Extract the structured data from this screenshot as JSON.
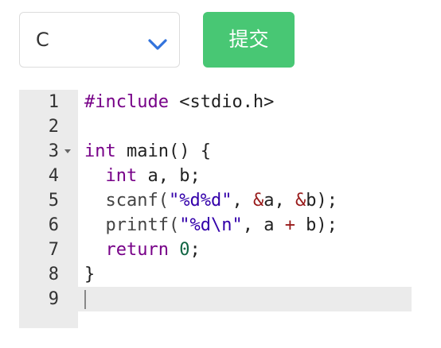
{
  "language_select": {
    "value": "C",
    "icon": "chevron-down-icon"
  },
  "submit_button": {
    "label": "提交",
    "color": "#48c774"
  },
  "editor": {
    "lines": [
      {
        "num": "1",
        "tokens": [
          {
            "t": "#include",
            "c": "kw"
          },
          {
            "t": " <stdio.h>",
            "c": "plain"
          }
        ]
      },
      {
        "num": "2",
        "tokens": []
      },
      {
        "num": "3",
        "fold": true,
        "tokens": [
          {
            "t": "int",
            "c": "ty"
          },
          {
            "t": " main() {",
            "c": "plain"
          }
        ]
      },
      {
        "num": "4",
        "tokens": [
          {
            "t": "  ",
            "c": "plain"
          },
          {
            "t": "int",
            "c": "ty"
          },
          {
            "t": " a, b;",
            "c": "plain"
          }
        ]
      },
      {
        "num": "5",
        "tokens": [
          {
            "t": "  scanf(",
            "c": "fn"
          },
          {
            "t": "\"%d%d\"",
            "c": "str2"
          },
          {
            "t": ", ",
            "c": "plain"
          },
          {
            "t": "&",
            "c": "op"
          },
          {
            "t": "a, ",
            "c": "plain"
          },
          {
            "t": "&",
            "c": "op"
          },
          {
            "t": "b);",
            "c": "plain"
          }
        ]
      },
      {
        "num": "6",
        "tokens": [
          {
            "t": "  printf(",
            "c": "fn"
          },
          {
            "t": "\"%d\\n\"",
            "c": "str2"
          },
          {
            "t": ", a ",
            "c": "plain"
          },
          {
            "t": "+",
            "c": "op"
          },
          {
            "t": " b);",
            "c": "plain"
          }
        ]
      },
      {
        "num": "7",
        "tokens": [
          {
            "t": "  ",
            "c": "plain"
          },
          {
            "t": "return",
            "c": "kw"
          },
          {
            "t": " ",
            "c": "plain"
          },
          {
            "t": "0",
            "c": "num"
          },
          {
            "t": ";",
            "c": "plain"
          }
        ]
      },
      {
        "num": "8",
        "tokens": [
          {
            "t": "}",
            "c": "plain"
          }
        ]
      },
      {
        "num": "9",
        "active": true,
        "tokens": []
      }
    ]
  }
}
